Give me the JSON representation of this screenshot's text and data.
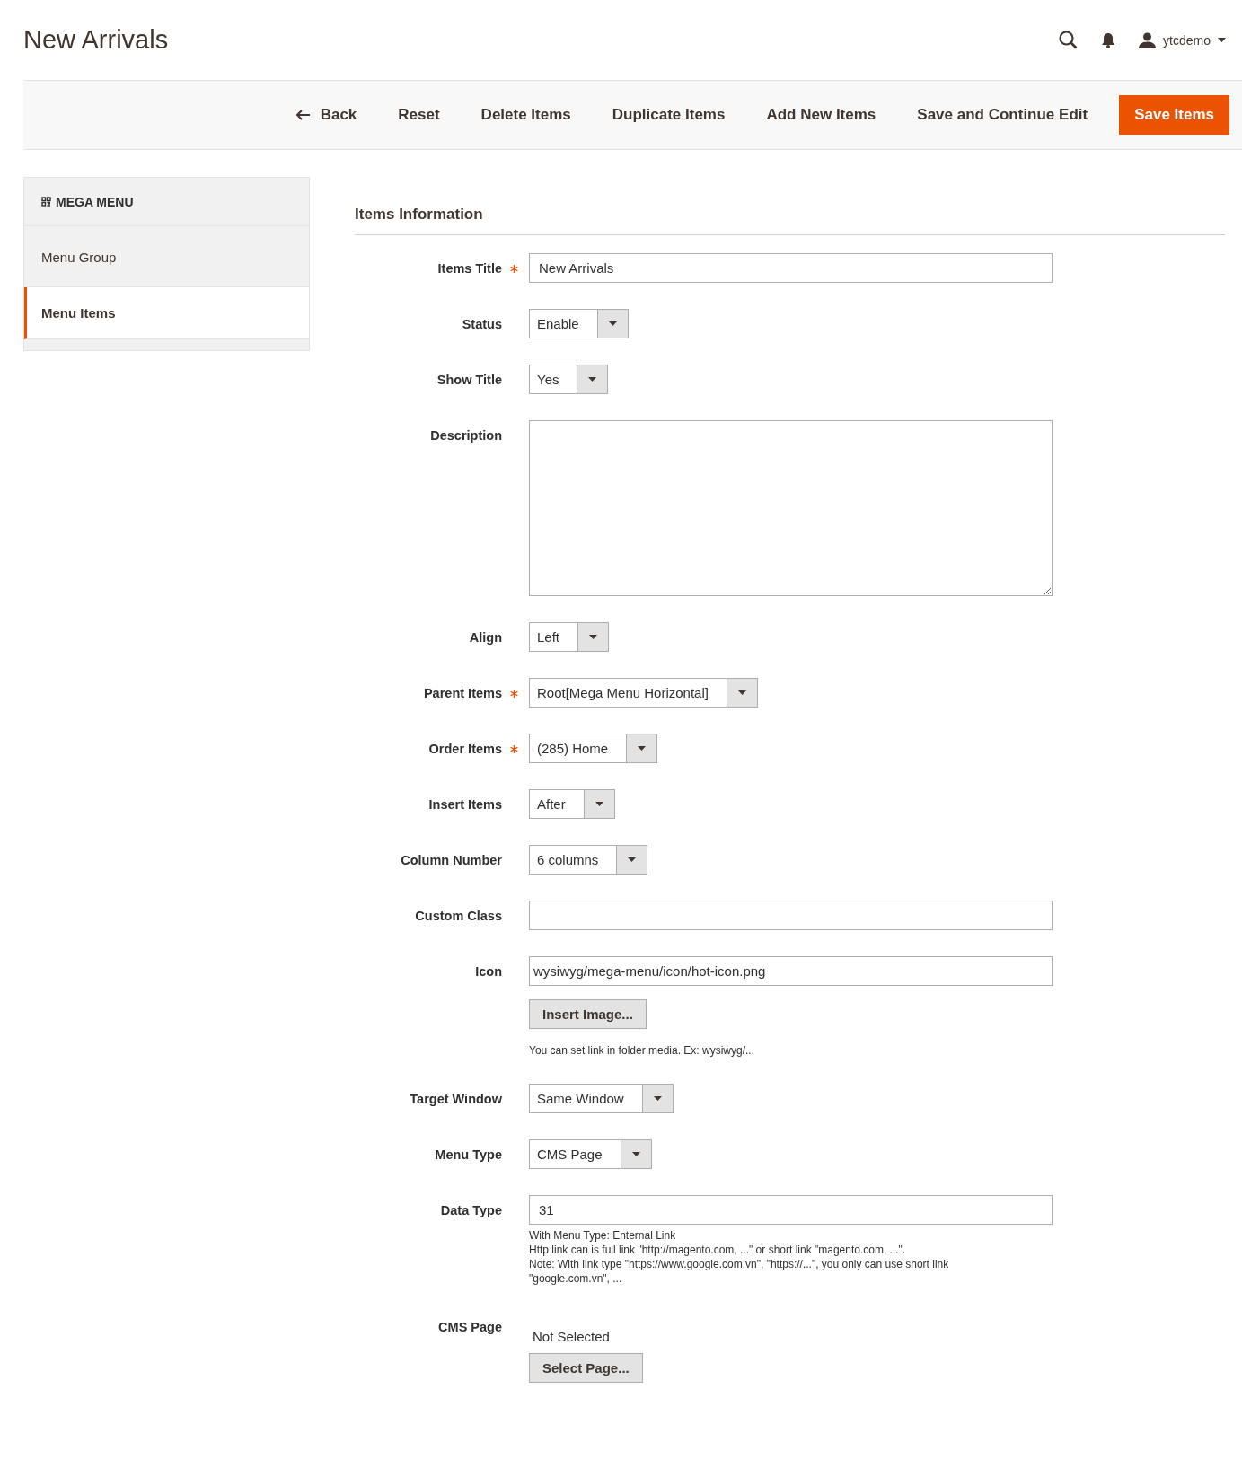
{
  "page_title": "New Arrivals",
  "header": {
    "user": "ytcdemo"
  },
  "toolbar": {
    "buttons": [
      {
        "label": "Back",
        "kind": "back"
      },
      {
        "label": "Reset",
        "kind": "plain"
      },
      {
        "label": "Delete Items",
        "kind": "plain"
      },
      {
        "label": "Duplicate Items",
        "kind": "plain"
      },
      {
        "label": "Add New Items",
        "kind": "plain"
      },
      {
        "label": "Save and Continue Edit",
        "kind": "plain"
      },
      {
        "label": "Save Items",
        "kind": "primary"
      }
    ]
  },
  "sidebar": {
    "title": "MEGA MENU",
    "items": [
      {
        "label": "Menu Group",
        "selected": false
      },
      {
        "label": "Menu Items",
        "selected": true
      }
    ]
  },
  "section": {
    "title": "Items Information",
    "fields": [
      {
        "kind": "text",
        "label": "Items Title",
        "required": true,
        "value": "New Arrivals"
      },
      {
        "kind": "select",
        "label": "Status",
        "required": false,
        "value": "Enable"
      },
      {
        "kind": "select",
        "label": "Show Title",
        "required": false,
        "value": "Yes"
      },
      {
        "kind": "textarea",
        "label": "Description",
        "required": false
      },
      {
        "kind": "select",
        "label": "Align",
        "required": false,
        "value": "Left"
      },
      {
        "kind": "select",
        "label": "Parent Items",
        "required": true,
        "value": "Root[Mega Menu Horizontal]"
      },
      {
        "kind": "select",
        "label": "Order Items",
        "required": true,
        "value": "(285) Home"
      },
      {
        "kind": "select",
        "label": "Insert Items",
        "required": false,
        "value": "After"
      },
      {
        "kind": "select",
        "label": "Column Number",
        "required": false,
        "value": "6 columns"
      },
      {
        "kind": "text",
        "label": "Custom Class",
        "required": false
      },
      {
        "kind": "text",
        "label": "Icon",
        "required": false,
        "value": "wysiwyg/mega-menu/icon/hot-icon.png",
        "button": "Insert Image...",
        "notes": [
          "You can set link in folder media. Ex: wysiwyg/..."
        ]
      },
      {
        "kind": "select",
        "label": "Target Window",
        "required": false,
        "value": "Same Window"
      },
      {
        "kind": "select",
        "label": "Menu Type",
        "required": false,
        "value": "CMS Page"
      },
      {
        "kind": "text",
        "label": "Data Type",
        "required": false,
        "value": "31",
        "notes": [
          "With Menu Type: Enternal Link",
          "Http link can is full link \"http://magento.com, ...\" or short link \"magento.com, ...\".",
          "Note: With link type \"https://www.google.com.vn\", \"https://...\", you only can use short link \"google.com.vn\", ..."
        ]
      },
      {
        "kind": "picker",
        "label": "CMS Page",
        "required": false,
        "value": "Not Selected",
        "button": "Select Page..."
      }
    ]
  }
}
